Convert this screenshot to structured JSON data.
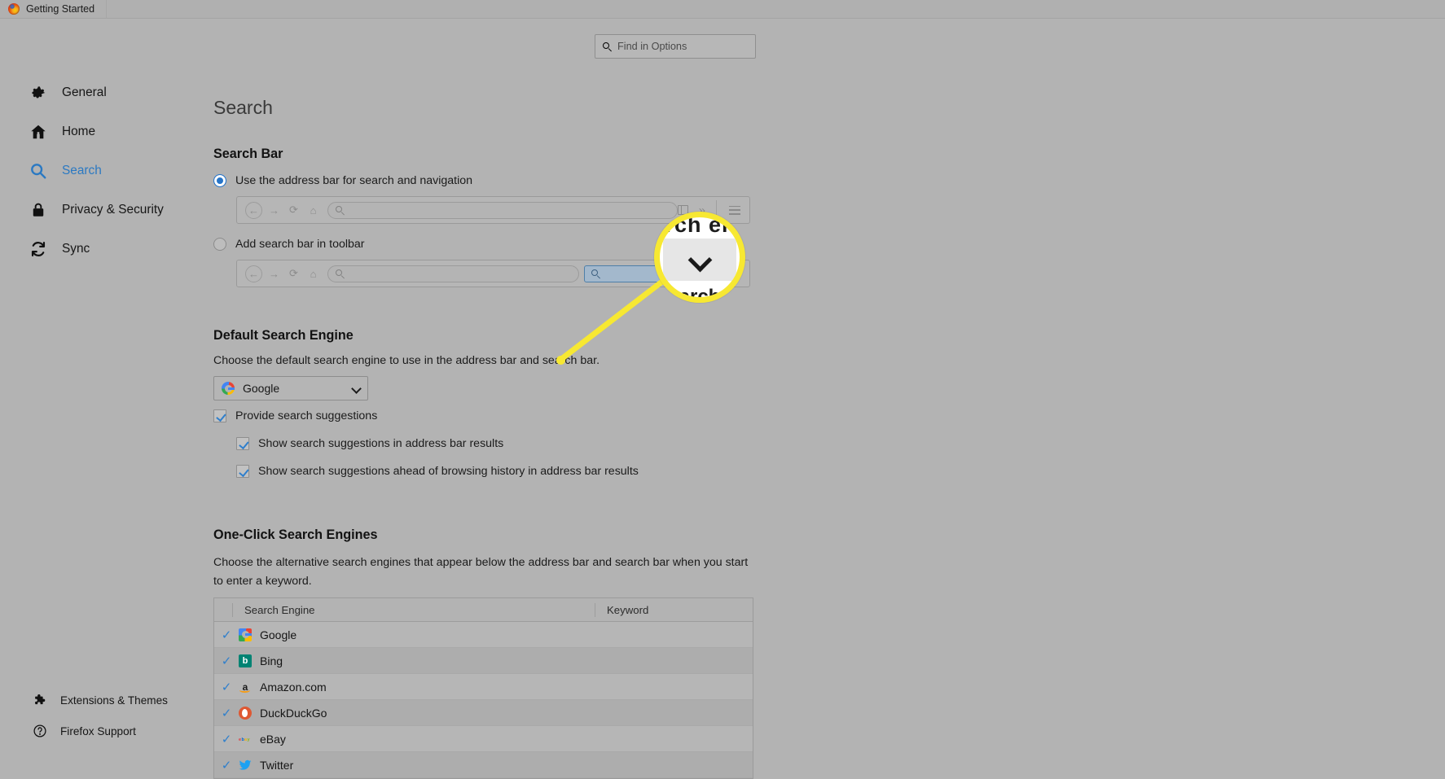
{
  "titlebar": {
    "tab_label": "Getting Started",
    "logo_icon": "firefox-logo"
  },
  "find": {
    "placeholder": "Find in Options",
    "icon": "search-icon"
  },
  "sidebar": {
    "items": [
      {
        "label": "General",
        "icon": "gear-icon",
        "active": false
      },
      {
        "label": "Home",
        "icon": "home-icon",
        "active": false
      },
      {
        "label": "Search",
        "icon": "search-icon",
        "active": true
      },
      {
        "label": "Privacy & Security",
        "icon": "lock-icon",
        "active": false
      },
      {
        "label": "Sync",
        "icon": "sync-icon",
        "active": false
      }
    ],
    "bottom_items": [
      {
        "label": "Extensions & Themes",
        "icon": "puzzle-icon"
      },
      {
        "label": "Firefox Support",
        "icon": "question-circle-icon"
      }
    ]
  },
  "main": {
    "page_title": "Search",
    "search_bar": {
      "heading": "Search Bar",
      "option_address_bar": "Use the address bar for search and navigation",
      "option_search_bar": "Add search bar in toolbar",
      "selected": "address_bar"
    },
    "default_engine": {
      "heading": "Default Search Engine",
      "description": "Choose the default search engine to use in the address bar and search bar.",
      "selected": "Google",
      "selected_icon": "google-icon"
    },
    "suggestions": [
      {
        "label": "Provide search suggestions",
        "checked": true
      },
      {
        "label": "Show search suggestions in address bar results",
        "checked": true
      },
      {
        "label": "Show search suggestions ahead of browsing history in address bar results",
        "checked": true
      }
    ],
    "one_click": {
      "heading": "One-Click Search Engines",
      "description": "Choose the alternative search engines that appear below the address bar and search bar when you start to enter a keyword.",
      "columns": [
        "Search Engine",
        "Keyword"
      ],
      "rows": [
        {
          "checked": "✓",
          "name": "Google",
          "keyword": "",
          "icon": "google-icon"
        },
        {
          "checked": "✓",
          "name": "Bing",
          "keyword": "",
          "icon": "bing-icon"
        },
        {
          "checked": "✓",
          "name": "Amazon.com",
          "keyword": "",
          "icon": "amazon-icon"
        },
        {
          "checked": "✓",
          "name": "DuckDuckGo",
          "keyword": "",
          "icon": "duckduckgo-icon"
        },
        {
          "checked": "✓",
          "name": "eBay",
          "keyword": "",
          "icon": "ebay-icon"
        },
        {
          "checked": "✓",
          "name": "Twitter",
          "keyword": "",
          "icon": "twitter-icon"
        }
      ]
    }
  },
  "callout": {
    "lens_top_text": "rch en",
    "lens_bottom_text": "arch",
    "lens_icon": "chevron-down-icon",
    "highlight_color": "#f7e832"
  },
  "colors": {
    "accent": "#2b79c2",
    "check": "#2f7fcc",
    "background": "#b3b3b3",
    "highlight": "#f7e832"
  }
}
